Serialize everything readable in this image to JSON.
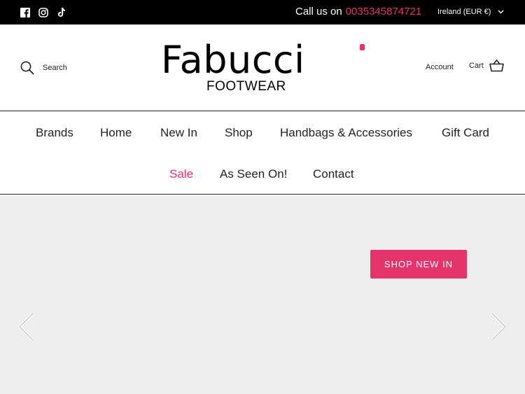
{
  "topbar": {
    "social": [
      "facebook-icon",
      "instagram-icon",
      "tiktok-icon"
    ],
    "call_label": "Call us on",
    "phone": "0035345874721",
    "locale": "Ireland (EUR €)"
  },
  "header": {
    "search_label": "Search",
    "logo_word": "Fabucci",
    "logo_sub": "FOOTWEAR",
    "account_label": "Account",
    "cart_label": "Cart"
  },
  "nav": {
    "items": [
      "Brands",
      "Home",
      "New In",
      "Shop",
      "Handbags & Accessories",
      "Gift Card",
      "Sale",
      "As Seen On!",
      "Contact"
    ]
  },
  "hero": {
    "cta_label": "SHOP NEW IN"
  },
  "colors": {
    "accent": "#e5336b",
    "topbar_bg": "#000000",
    "hero_bg": "#eeeeee"
  }
}
